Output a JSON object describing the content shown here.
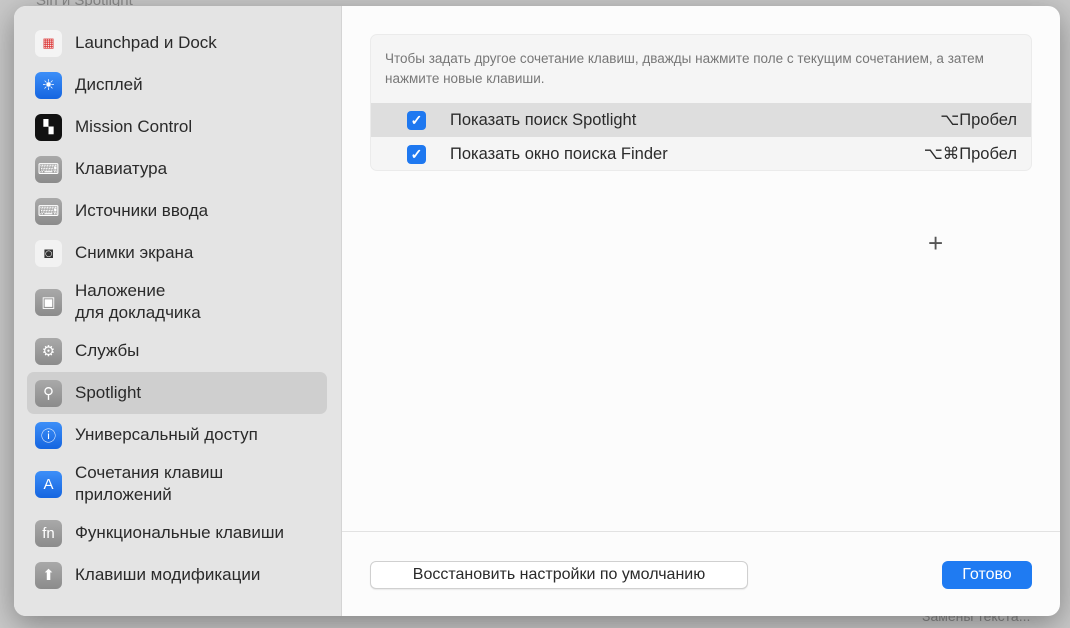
{
  "background": {
    "title": "Siri и Spotlight",
    "bottom_text": "Замены текста..."
  },
  "sidebar": {
    "items": [
      {
        "label": "Launchpad и Dock",
        "icon": "launchpad-icon"
      },
      {
        "label": "Дисплей",
        "icon": "display-icon"
      },
      {
        "label": "Mission Control",
        "icon": "mission-control-icon"
      },
      {
        "label": "Клавиатура",
        "icon": "keyboard-icon"
      },
      {
        "label": "Источники ввода",
        "icon": "input-sources-icon"
      },
      {
        "label": "Снимки экрана",
        "icon": "screenshot-icon"
      },
      {
        "label": "Наложение",
        "label2": "для докладчика",
        "icon": "presenter-overlay-icon"
      },
      {
        "label": "Службы",
        "icon": "services-icon"
      },
      {
        "label": "Spotlight",
        "icon": "spotlight-icon",
        "selected": true
      },
      {
        "label": "Универсальный доступ",
        "icon": "accessibility-icon"
      },
      {
        "label": "Сочетания клавиш",
        "label2": "приложений",
        "icon": "app-shortcuts-icon"
      },
      {
        "label": "Функциональные клавиши",
        "icon": "fn-icon"
      },
      {
        "label": "Клавиши модификации",
        "icon": "modifier-keys-icon"
      }
    ]
  },
  "main": {
    "hint": "Чтобы задать другое сочетание клавиш, дважды нажмите поле с текущим сочетанием, а затем нажмите новые клавиши.",
    "shortcuts": [
      {
        "label": "Показать поиск Spotlight",
        "keys": "⌥Пробел",
        "checked": true
      },
      {
        "label": "Показать окно поиска Finder",
        "keys": "⌥⌘Пробел",
        "checked": true
      }
    ],
    "add_icon": "+"
  },
  "footer": {
    "restore_label": "Восстановить настройки по умолчанию",
    "done_label": "Готово"
  },
  "colors": {
    "accent": "#1f7bf2",
    "selection": "#cfcfcf"
  }
}
